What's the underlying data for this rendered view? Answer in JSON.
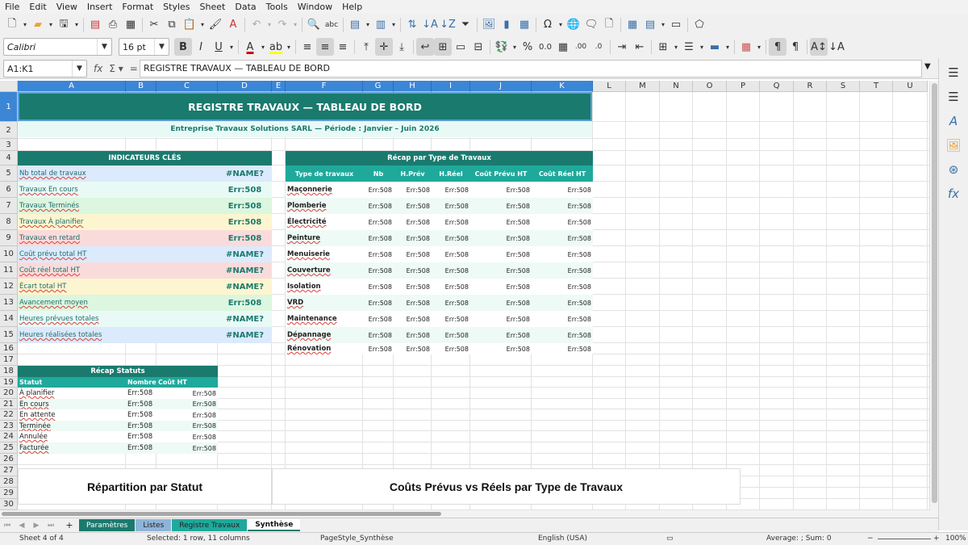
{
  "menu": [
    "File",
    "Edit",
    "View",
    "Insert",
    "Format",
    "Styles",
    "Sheet",
    "Data",
    "Tools",
    "Window",
    "Help"
  ],
  "toolbar": {
    "font_name": "Calibri",
    "font_size": "16 pt"
  },
  "formula_bar": {
    "name_box": "A1:K1",
    "content": "REGISTRE TRAVAUX — TABLEAU DE BORD"
  },
  "columns": [
    "A",
    "B",
    "C",
    "D",
    "E",
    "F",
    "G",
    "H",
    "I",
    "J",
    "K",
    "L",
    "M",
    "N",
    "O",
    "P",
    "Q",
    "R",
    "S",
    "T",
    "U"
  ],
  "rows": [
    "1",
    "2",
    "3",
    "4",
    "5",
    "6",
    "7",
    "8",
    "9",
    "10",
    "11",
    "12",
    "13",
    "14",
    "15",
    "16",
    "17",
    "18",
    "19",
    "20",
    "21",
    "22",
    "23",
    "24",
    "25",
    "26",
    "27",
    "28",
    "29",
    "30"
  ],
  "sheet": {
    "title": "REGISTRE TRAVAUX — TABLEAU DE BORD",
    "subtitle": "Entreprise Travaux Solutions SARL — Période : Janvier – Juin 2026",
    "kpi_header": "INDICATEURS CLÉS",
    "kpis": [
      {
        "label": "Nb total de travaux",
        "value": "#NAME?",
        "bg": "#dbeafc"
      },
      {
        "label": "Travaux En cours",
        "value": "Err:508",
        "bg": "#e9faf6"
      },
      {
        "label": "Travaux Terminés",
        "value": "Err:508",
        "bg": "#dcf6df"
      },
      {
        "label": "Travaux À planifier",
        "value": "Err:508",
        "bg": "#fdf5cf"
      },
      {
        "label": "Travaux en retard",
        "value": "Err:508",
        "bg": "#fadbdb"
      },
      {
        "label": "Coût prévu total HT",
        "value": "#NAME?",
        "bg": "#dbeafc"
      },
      {
        "label": "Coût réel total HT",
        "value": "#NAME?",
        "bg": "#fadbdb"
      },
      {
        "label": "Écart total HT",
        "value": "#NAME?",
        "bg": "#fdf5cf"
      },
      {
        "label": "Avancement moyen",
        "value": "Err:508",
        "bg": "#dcf6df"
      },
      {
        "label": "Heures prévues totales",
        "value": "#NAME?",
        "bg": "#e9faf6"
      },
      {
        "label": "Heures réalisées totales",
        "value": "#NAME?",
        "bg": "#dbeafc"
      }
    ],
    "recap_type_header": "Récap par Type de Travaux",
    "recap_type_cols": [
      "Type de travaux",
      "Nb",
      "H.Prév",
      "H.Réel",
      "Coût Prévu HT",
      "Coût Réel HT"
    ],
    "recap_types": [
      "Maçonnerie",
      "Plomberie",
      "Électricité",
      "Peinture",
      "Menuiserie",
      "Couverture",
      "Isolation",
      "VRD",
      "Maintenance",
      "Dépannage",
      "Rénovation"
    ],
    "err": "Err:508",
    "recap_statut_header": "Récap Statuts",
    "recap_statut_cols": [
      "Statut",
      "Nombre",
      "Coût HT"
    ],
    "statuts": [
      "À planifier",
      "En cours",
      "En attente",
      "Terminée",
      "Annulée",
      "Facturée"
    ],
    "chart1_title": "Répartition par Statut",
    "chart2_title": "Coûts Prévus vs Réels par Type de Travaux"
  },
  "tabs": [
    {
      "label": "Paramètres",
      "bg": "#1a7a6e",
      "fg": "#ffffff"
    },
    {
      "label": "Listes",
      "bg": "#8fb4d8",
      "fg": "#222222"
    },
    {
      "label": "Registre Travaux",
      "bg": "#1fa99b",
      "fg": "#222222"
    },
    {
      "label": "Synthèse",
      "bg": "#ffffff",
      "fg": "#111111"
    }
  ],
  "status": {
    "sheet": "Sheet 4 of 4",
    "selection": "Selected: 1 row, 11 columns",
    "page_style": "PageStyle_Synthèse",
    "language": "English (USA)",
    "summary": "Average: ; Sum: 0",
    "zoom": "100%"
  }
}
